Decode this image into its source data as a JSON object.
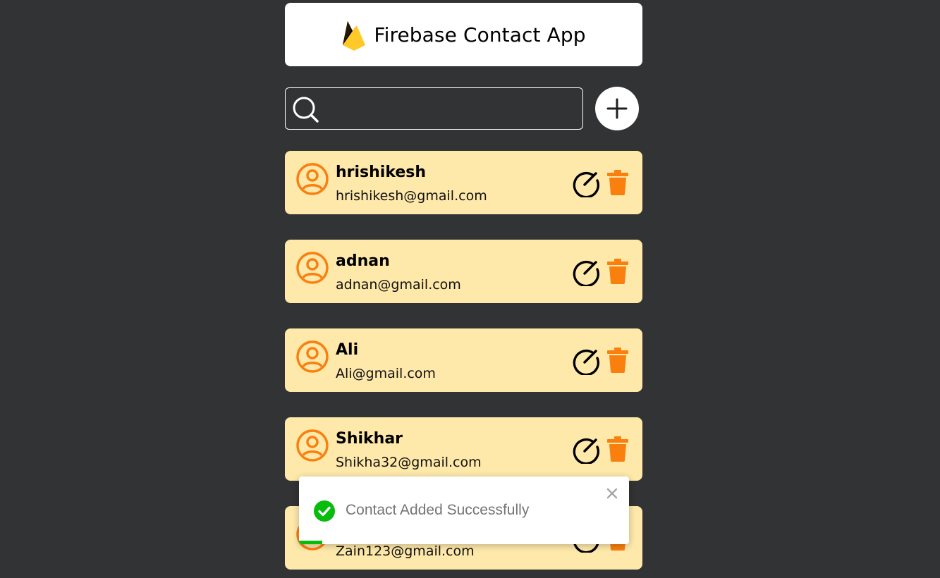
{
  "header": {
    "title": "Firebase Contact App",
    "logo_icon": "firebase-flame-icon"
  },
  "search": {
    "placeholder": "",
    "value": "",
    "icon": "search-icon"
  },
  "add_button": {
    "icon": "plus-icon"
  },
  "contacts": [
    {
      "name": "hrishikesh",
      "email": "hrishikesh@gmail.com"
    },
    {
      "name": "adnan",
      "email": "adnan@gmail.com"
    },
    {
      "name": "Ali",
      "email": "Ali@gmail.com"
    },
    {
      "name": "Shikhar",
      "email": "Shikha32@gmail.com"
    },
    {
      "name": "",
      "email": "Zain123@gmail.com"
    }
  ],
  "toast": {
    "message": "Contact Added Successfully",
    "type": "success",
    "progress": 0.07
  },
  "colors": {
    "background": "#323334",
    "card": "#fee8aa",
    "accent": "#f97f0f",
    "success": "#07bc0c"
  }
}
